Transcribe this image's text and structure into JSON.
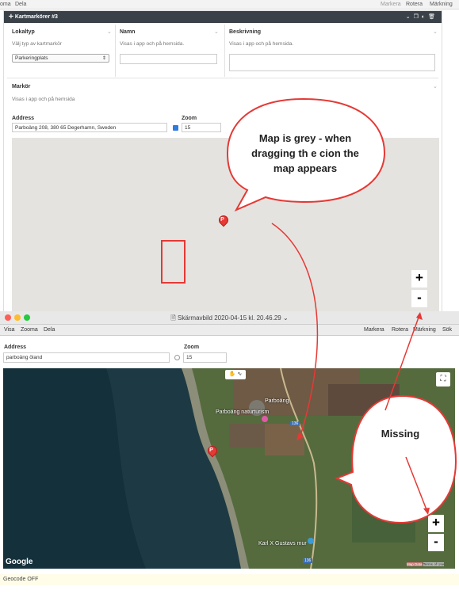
{
  "top_menubar": {
    "left_items": [
      "oma",
      "Dela"
    ],
    "right_items": [
      "Markera",
      "Rotera",
      "Märkning"
    ]
  },
  "panel": {
    "title": "Kartmarkörer #3",
    "lokaltyp": {
      "label": "Lokaltyp",
      "help": "Välj typ av kartmarkör",
      "value": "Parkeringplats"
    },
    "namn": {
      "label": "Namn",
      "help": "Visas i app och på hemsida.",
      "value": ""
    },
    "beskrivning": {
      "label": "Beskrivning",
      "help": "Visas i app och på hemsida.",
      "value": ""
    },
    "markor": {
      "label": "Markör",
      "help": "Visas i app och på hemsida"
    },
    "address": {
      "label": "Address",
      "value": "Parboäng 208, 380 65 Degerhamn, Sweden",
      "checked": true
    },
    "zoom": {
      "label": "Zoom",
      "value": "15"
    },
    "map_marker_letter": "P"
  },
  "annotation_top": {
    "text": "Map is grey - when dragging th e cion the map appears"
  },
  "annotation_bottom": {
    "text": "Missing"
  },
  "zoom_controls": {
    "plus": "+",
    "minus": "-"
  },
  "window": {
    "title": "Skärmavbild 2020-04-15 kl. 20.46.29",
    "menu_left": [
      "Visa",
      "Zooma",
      "Dela"
    ],
    "menu_right": [
      "Markera",
      "Rotera",
      "Märkning",
      "Sök"
    ],
    "address": {
      "label": "Address",
      "value": "parboäng öland",
      "checked": false
    },
    "zoom": {
      "label": "Zoom",
      "value": "15"
    },
    "map": {
      "labels": [
        "Parboäng",
        "Parboäng naturturism",
        "Karl X Gustavs mur"
      ],
      "road_number": "136",
      "google": "Google",
      "attribution": [
        "Map Data",
        "Terms of Use"
      ],
      "marker_letter": "P"
    },
    "geocode_status": "Geocode OFF"
  },
  "colors": {
    "accent_red": "#e53935",
    "header_dark": "#3a4148"
  }
}
